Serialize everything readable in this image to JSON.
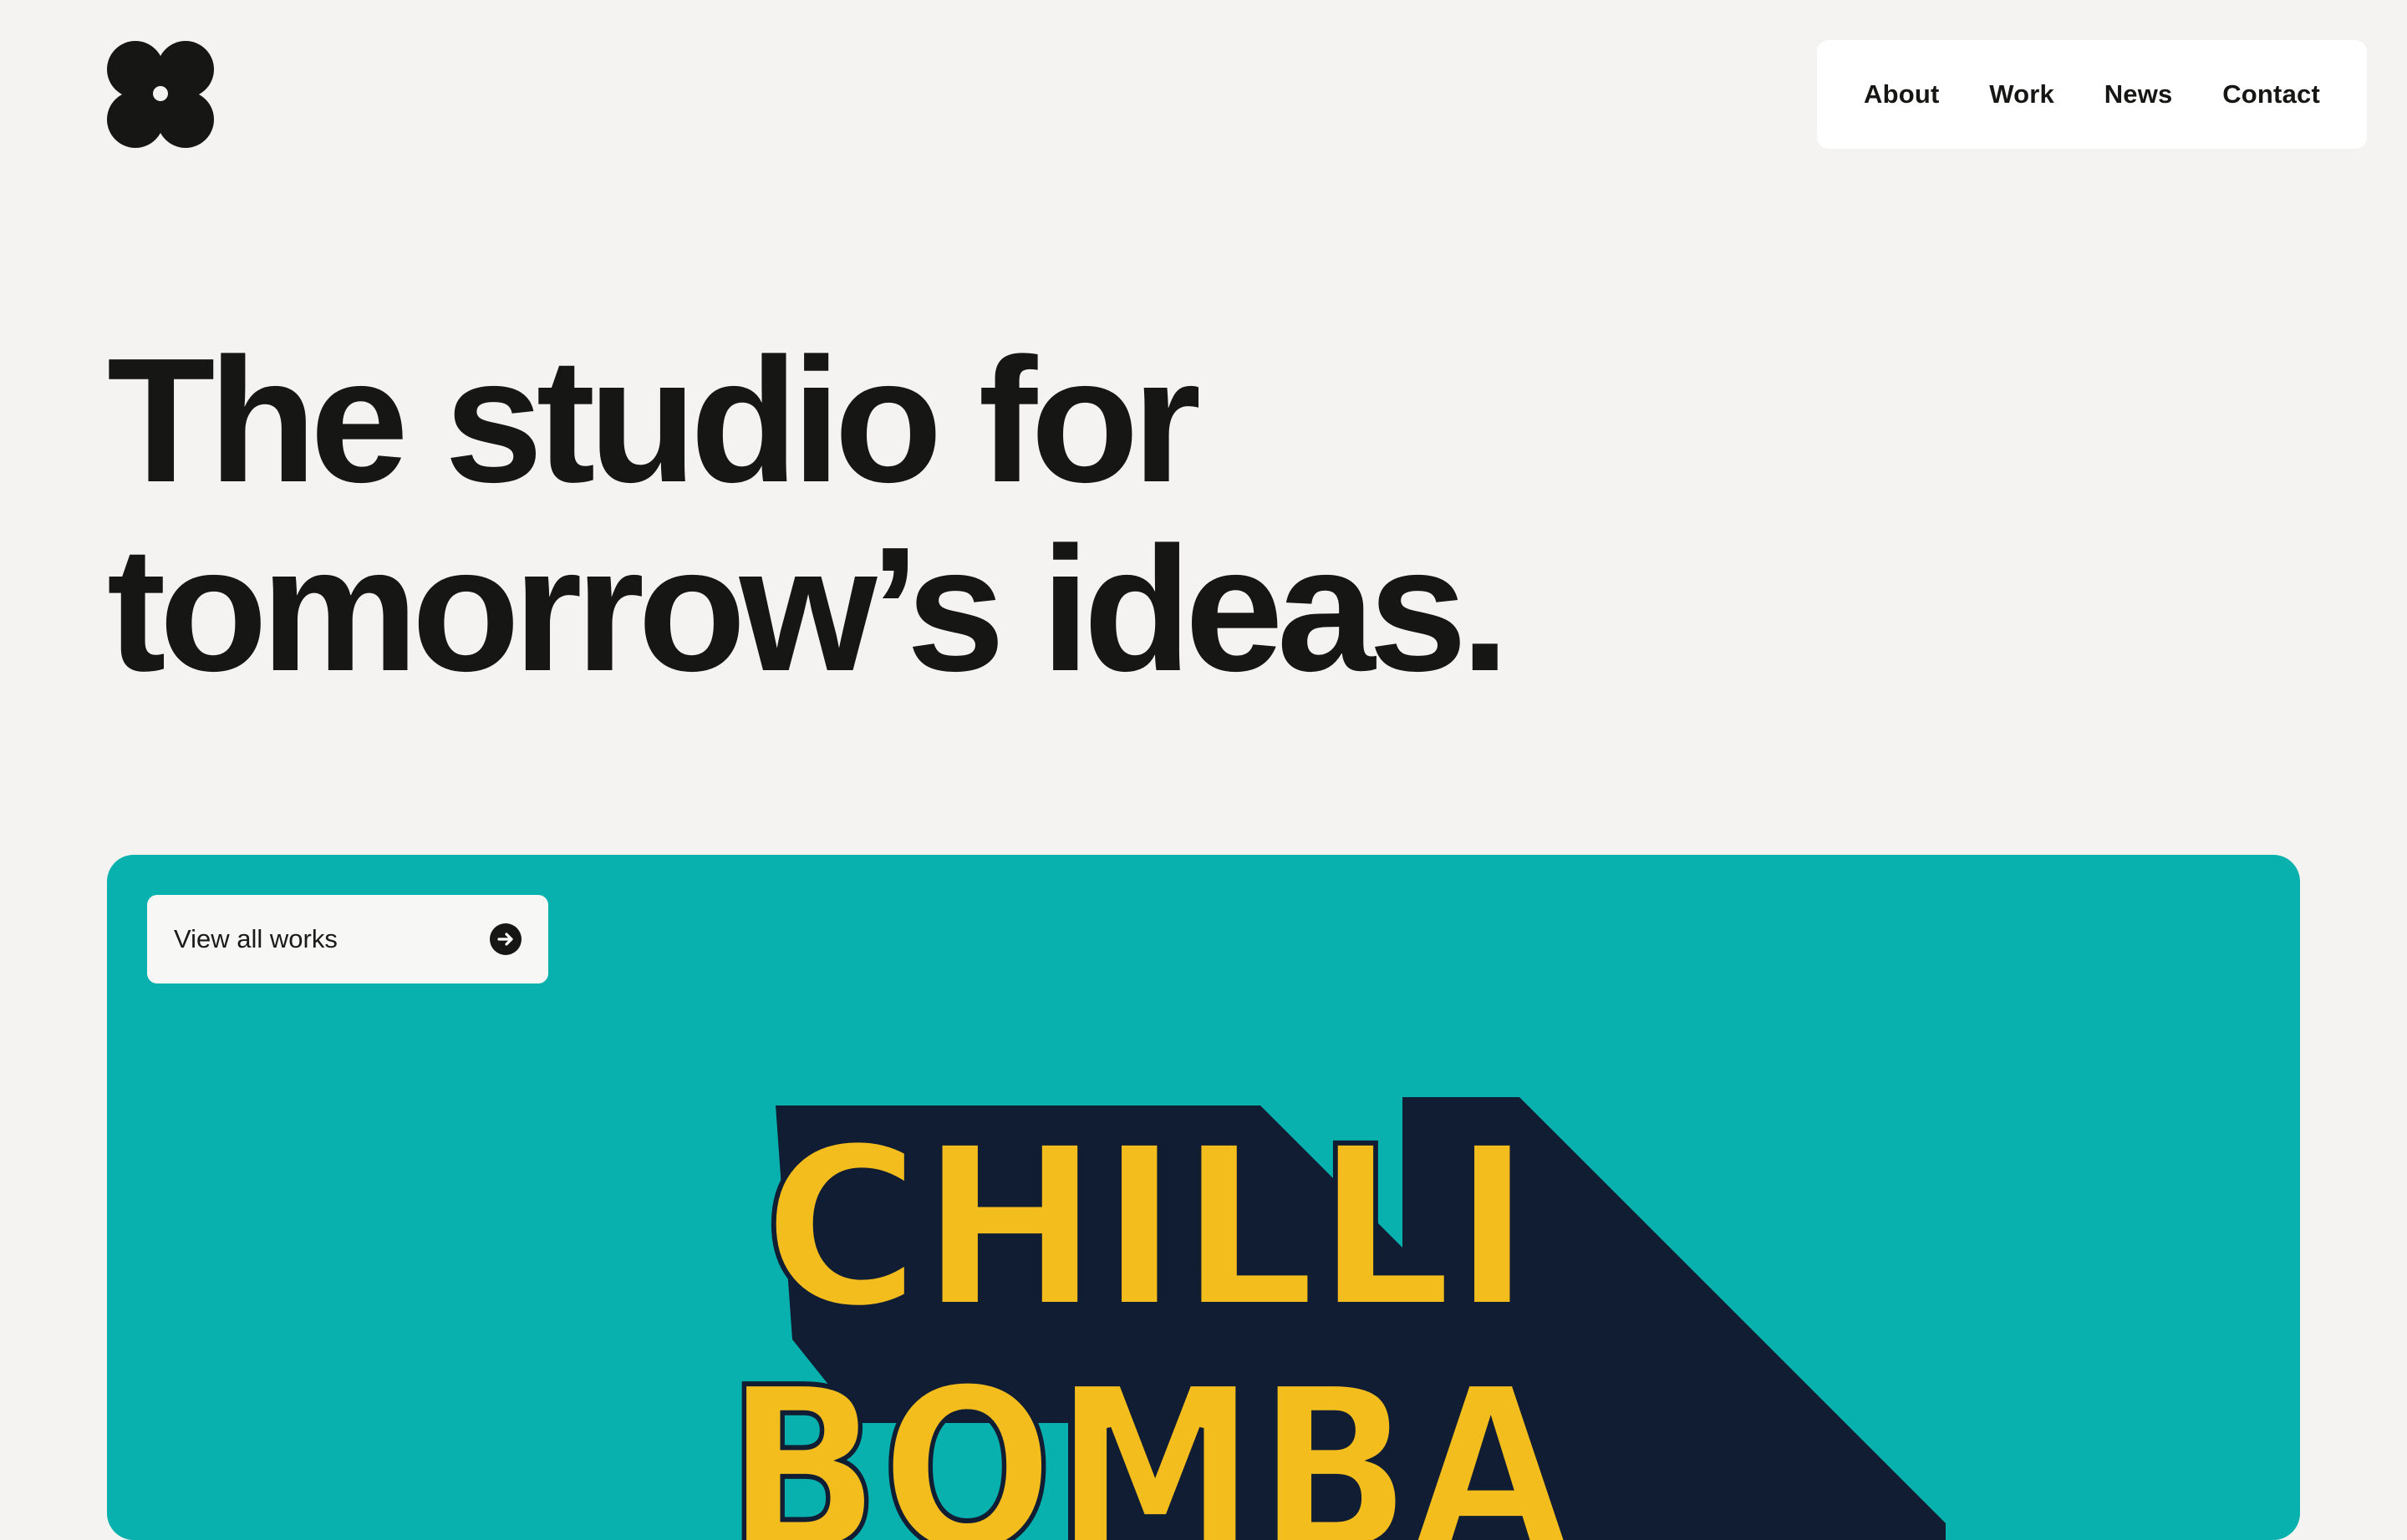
{
  "nav": {
    "items": [
      {
        "label": "About"
      },
      {
        "label": "Work"
      },
      {
        "label": "News"
      },
      {
        "label": "Contact"
      }
    ]
  },
  "hero": {
    "line1": "The studio for",
    "line2": "tomorrow’s ideas."
  },
  "featured": {
    "button_label": "View all works",
    "button_icon": "arrow-right-circle-icon",
    "artwork": {
      "line1": "CHILLI",
      "line2": "BOMBA"
    }
  },
  "colors": {
    "page_background": "#f4f3f1",
    "text": "#161614",
    "card_teal": "#08b1ae",
    "art_yellow": "#f3bd1d",
    "art_navy": "#111d32"
  }
}
